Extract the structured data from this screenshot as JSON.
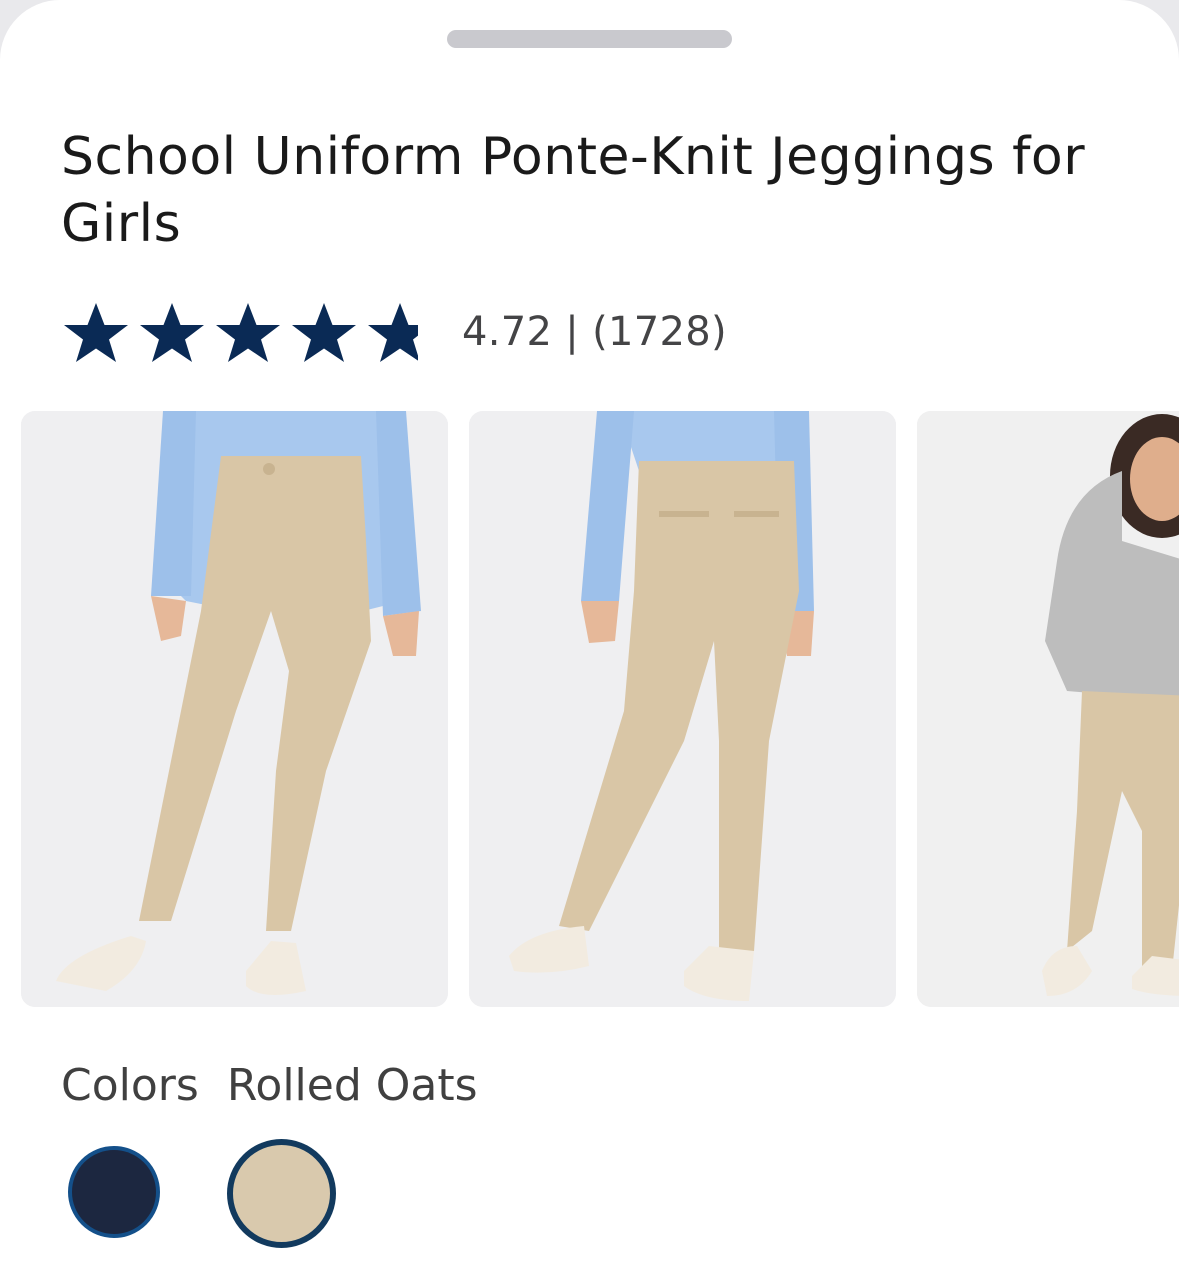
{
  "product": {
    "title": "School Uniform Ponte-Knit Jeggings for Girls"
  },
  "rating": {
    "stars": 4.72,
    "max_stars": 5,
    "text": "4.72 | (1728)",
    "star_color": "#0a2a55"
  },
  "gallery": {
    "images": [
      {
        "icon": "front-view-photo"
      },
      {
        "icon": "back-view-photo"
      },
      {
        "icon": "model-in-hoodie-photo"
      }
    ]
  },
  "colors": {
    "label": "Colors",
    "selected_name": "Rolled Oats",
    "swatches": [
      {
        "icon": "navy-swatch",
        "color": "#1c2740",
        "selected": false
      },
      {
        "icon": "khaki-swatch",
        "color": "#d9c9ad",
        "selected": true
      }
    ],
    "selected_ring_color": "#123a5e"
  }
}
